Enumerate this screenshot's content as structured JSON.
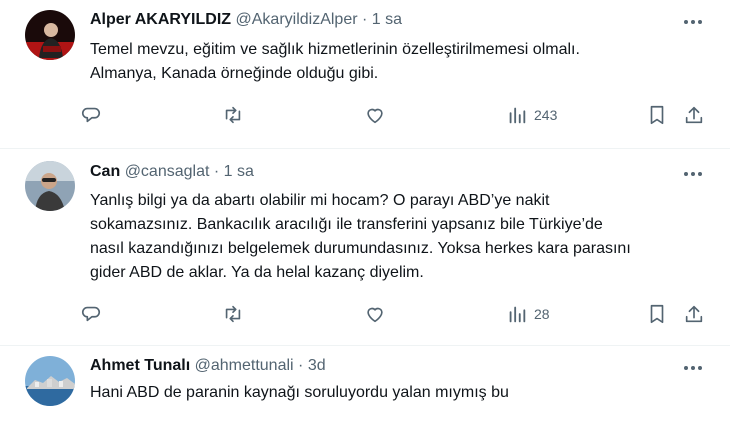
{
  "tweets": [
    {
      "name": "Alper AKARYILDIZ",
      "handle": "@AkaryildizAlper",
      "dot": "·",
      "time": "1 sa",
      "lines": [
        "Temel mevzu, eğitim ve sağlık hizmetlerinin özelleştirilmemesi olmalı.",
        "Almanya, Kanada örneğinde olduğu gibi."
      ],
      "views": "243"
    },
    {
      "name": "Can",
      "handle": "@cansaglat",
      "dot": "·",
      "time": "1 sa",
      "lines": [
        "Yanlış bilgi ya da abartı olabilir mi hocam? O parayı ABD’ye nakit",
        "sokamazsınız. Bankacılık aracılığı ile transferini yapsanız bile Türkiye’de",
        "nasıl kazandığınızı belgelemek durumundasınız. Yoksa herkes kara parasını",
        "gider ABD de aklar. Ya da helal kazanç diyelim."
      ],
      "views": "28"
    },
    {
      "name": "Ahmet Tunalı",
      "handle": "@ahmettunali",
      "dot": "·",
      "time": "3d",
      "lines": [
        "Hani ABD de paranin kaynağı soruluyordu yalan mıymış bu"
      ]
    }
  ],
  "icons": {
    "more": "more-icon",
    "reply": "reply-icon",
    "retweet": "retweet-icon",
    "like": "like-icon",
    "views": "views-icon",
    "bookmark": "bookmark-icon",
    "share": "share-icon"
  },
  "colors": {
    "text": "#0f1419",
    "secondary": "#536471",
    "divider": "#eff3f4"
  }
}
